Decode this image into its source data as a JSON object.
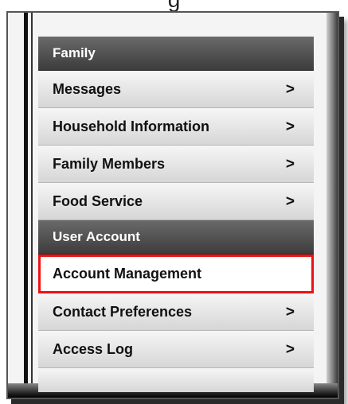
{
  "top_caption": "g",
  "menu": {
    "family_header": "Family",
    "family_items": [
      {
        "label": "Messages",
        "chevron": ">"
      },
      {
        "label": "Household Information",
        "chevron": ">"
      },
      {
        "label": "Family Members",
        "chevron": ">"
      },
      {
        "label": "Food Service",
        "chevron": ">"
      }
    ],
    "account_header": "User Account",
    "account_items": [
      {
        "label": "Account Management",
        "chevron": ""
      },
      {
        "label": "Contact Preferences",
        "chevron": ">"
      },
      {
        "label": "Access Log",
        "chevron": ">"
      }
    ]
  },
  "colors": {
    "highlight": "#ee1111",
    "section_bg": "#4a4a4a"
  }
}
